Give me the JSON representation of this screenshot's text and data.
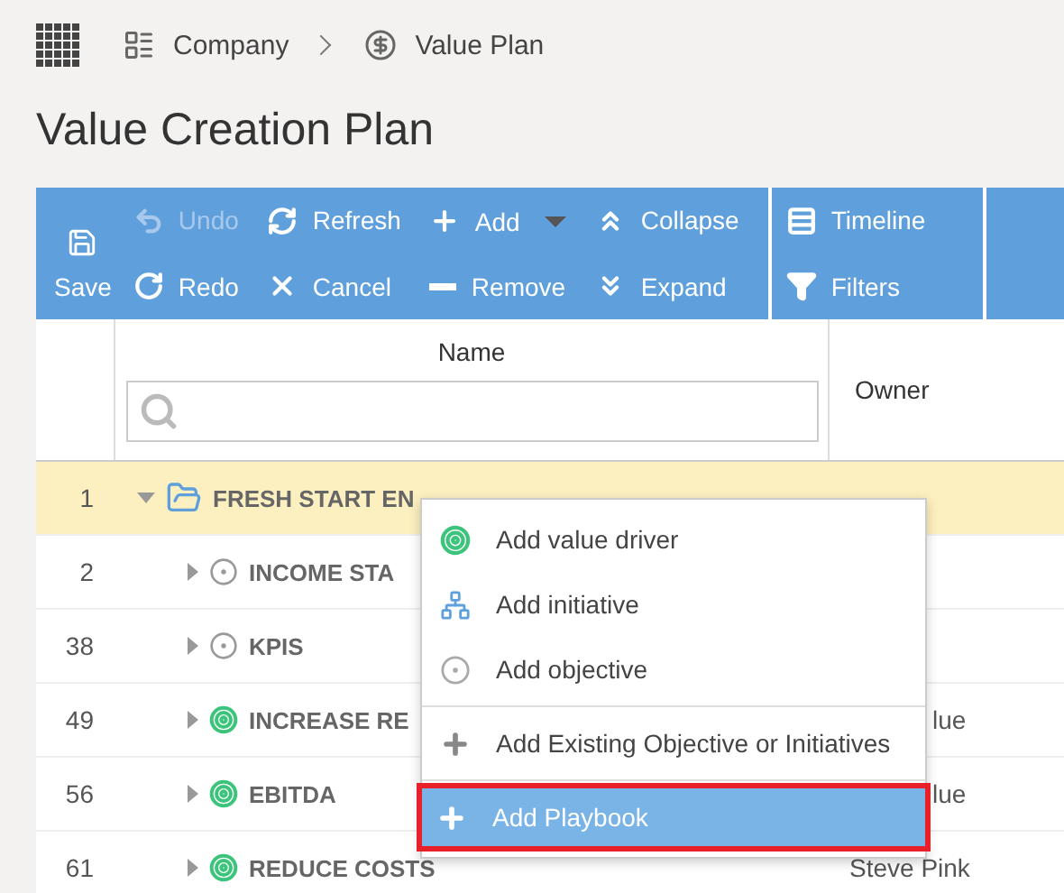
{
  "breadcrumb": [
    {
      "label": "Company",
      "kind": "board"
    },
    {
      "label": "Value Plan",
      "kind": "dollar"
    }
  ],
  "page_title": "Value Creation Plan",
  "toolbar": {
    "save": "Save",
    "columns": [
      [
        {
          "label": "Undo",
          "kind": "undo",
          "disabled": true
        },
        {
          "label": "Redo",
          "kind": "redo",
          "disabled": false
        }
      ],
      [
        {
          "label": "Refresh",
          "kind": "refresh",
          "disabled": false
        },
        {
          "label": "Cancel",
          "kind": "cancel",
          "disabled": false
        }
      ],
      [
        {
          "label": "Add",
          "kind": "add",
          "disabled": false,
          "dropdown": true
        },
        {
          "label": "Remove",
          "kind": "remove",
          "disabled": false
        }
      ],
      [
        {
          "label": "Collapse",
          "kind": "collapse",
          "disabled": false
        },
        {
          "label": "Expand",
          "kind": "expand",
          "disabled": false
        }
      ]
    ],
    "view": [
      {
        "label": "Timeline",
        "kind": "timeline"
      },
      {
        "label": "Filters",
        "kind": "filter"
      }
    ]
  },
  "table": {
    "columns": [
      "Name",
      "Owner"
    ],
    "rows": [
      {
        "number": "1",
        "name": "FRESH START EN",
        "kind": "folder",
        "expanded": true,
        "selected": true
      },
      {
        "number": "2",
        "name": "INCOME STA",
        "kind": "objective",
        "expanded": false,
        "selected": false
      },
      {
        "number": "38",
        "name": "KPIS",
        "kind": "objective",
        "expanded": false,
        "selected": false
      },
      {
        "number": "49",
        "name": "INCREASE RE",
        "kind": "driver",
        "expanded": false,
        "selected": false,
        "owner": "lue"
      },
      {
        "number": "56",
        "name": "EBITDA",
        "kind": "driver",
        "expanded": false,
        "selected": false,
        "owner": "lue"
      },
      {
        "number": "61",
        "name": "REDUCE COSTS",
        "kind": "driver",
        "expanded": false,
        "selected": false,
        "owner": "Steve Pink"
      }
    ]
  },
  "context_menu": [
    {
      "label": "Add value driver",
      "kind": "driver",
      "divider_before": false,
      "selected": false
    },
    {
      "label": "Add initiative",
      "kind": "initiative",
      "divider_before": false,
      "selected": false
    },
    {
      "label": "Add objective",
      "kind": "objective",
      "divider_before": false,
      "selected": false
    },
    {
      "label": "Add Existing Objective or Initiatives",
      "kind": "plus",
      "divider_before": true,
      "selected": false
    },
    {
      "label": "Add Playbook",
      "kind": "plus",
      "divider_before": true,
      "selected": true
    }
  ]
}
